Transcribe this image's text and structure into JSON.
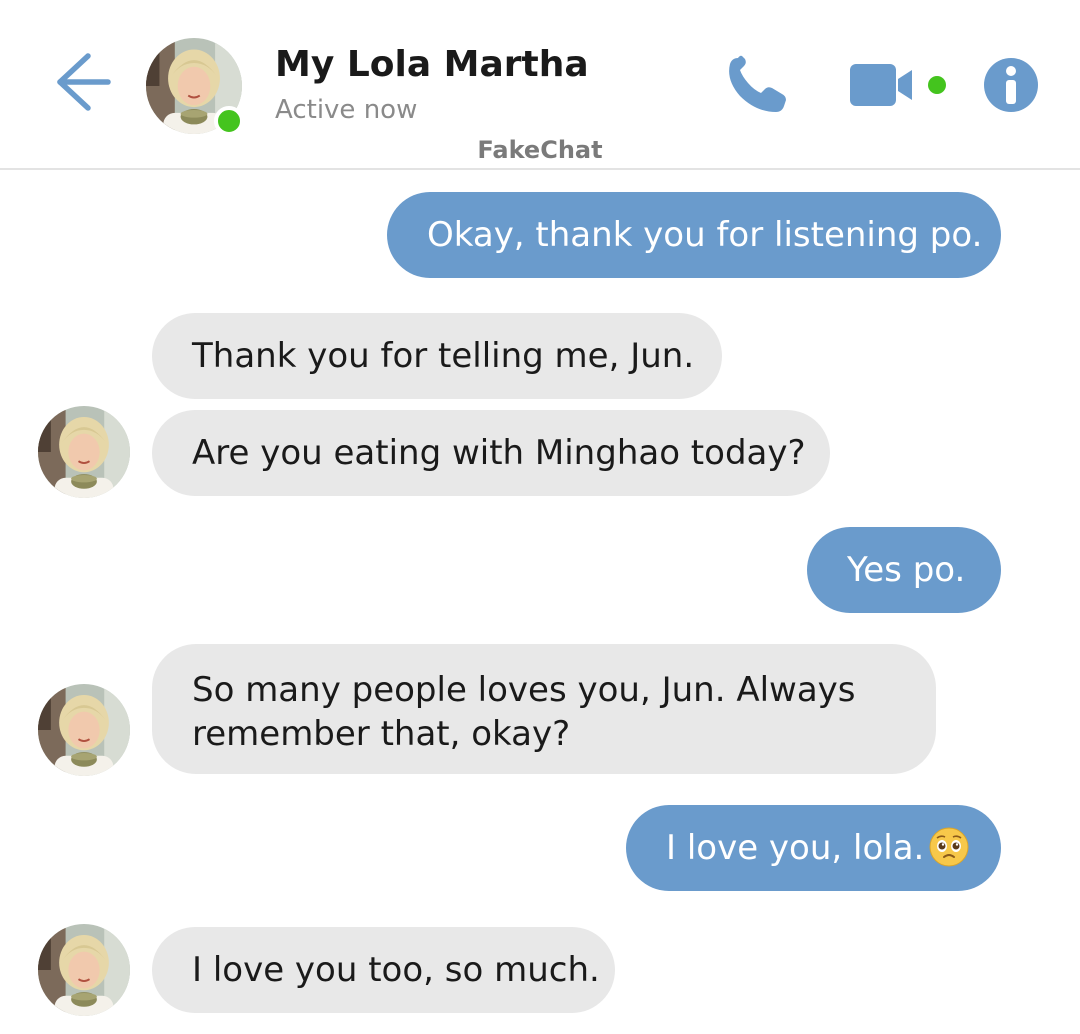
{
  "header": {
    "contact_name": "My Lola Martha",
    "status": "Active now",
    "app_label": "FakeChat",
    "icons": {
      "back": "back-arrow-icon",
      "phone": "phone-icon",
      "video": "video-camera-icon",
      "info": "info-icon"
    },
    "colors": {
      "accent": "#6a9bcc",
      "online": "#44c41e"
    }
  },
  "messages": [
    {
      "direction": "outgoing",
      "text": "Okay, thank you for listening po."
    },
    {
      "direction": "incoming",
      "text": "Thank you for telling me, Jun."
    },
    {
      "direction": "incoming",
      "text": "Are you eating with Minghao today?"
    },
    {
      "direction": "outgoing",
      "text": "Yes po."
    },
    {
      "direction": "incoming",
      "text": "So many people loves you, Jun. Always remember that, okay?"
    },
    {
      "direction": "outgoing",
      "text": "I love you, lola.",
      "emoji": "pleading-face-emoji"
    },
    {
      "direction": "incoming",
      "text": "I love you too, so much."
    }
  ],
  "colors": {
    "outgoing_bubble": "#6a9bcc",
    "incoming_bubble": "#e8e8e8"
  }
}
